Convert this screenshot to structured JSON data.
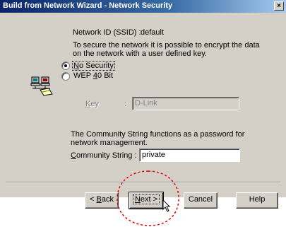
{
  "window": {
    "title": "Build from Network Wizard - Network Security",
    "close_glyph": "×"
  },
  "ssid": {
    "label": "Network ID (SSID) :",
    "value": "default"
  },
  "description": {
    "line1": "To secure the network it is possible to encrypt the data",
    "line2": "on the network with a user defined key."
  },
  "security_options": [
    {
      "pre": "",
      "mnemonic": "N",
      "post": "o Security",
      "checked": true
    },
    {
      "pre": "WEP ",
      "mnemonic": "4",
      "post": "0 Bit",
      "checked": false
    }
  ],
  "key": {
    "mnemonic": "K",
    "post": "ey",
    "separator": ":",
    "value": "D-Link"
  },
  "community": {
    "line1": "The Community String functions as a password for",
    "line2": "network management.",
    "label_mnemonic": "C",
    "label_post": "ommunity String :",
    "value": "private"
  },
  "buttons": {
    "back": {
      "pre": "< ",
      "mnemonic": "B",
      "post": "ack"
    },
    "next": {
      "mnemonic": "N",
      "post": "ext >"
    },
    "cancel": {
      "label": "Cancel"
    },
    "help": {
      "label": "Help"
    }
  },
  "icon": "network-computers-icon",
  "colors": {
    "annotation": "#e00000",
    "titlebar": "#0a246a"
  }
}
